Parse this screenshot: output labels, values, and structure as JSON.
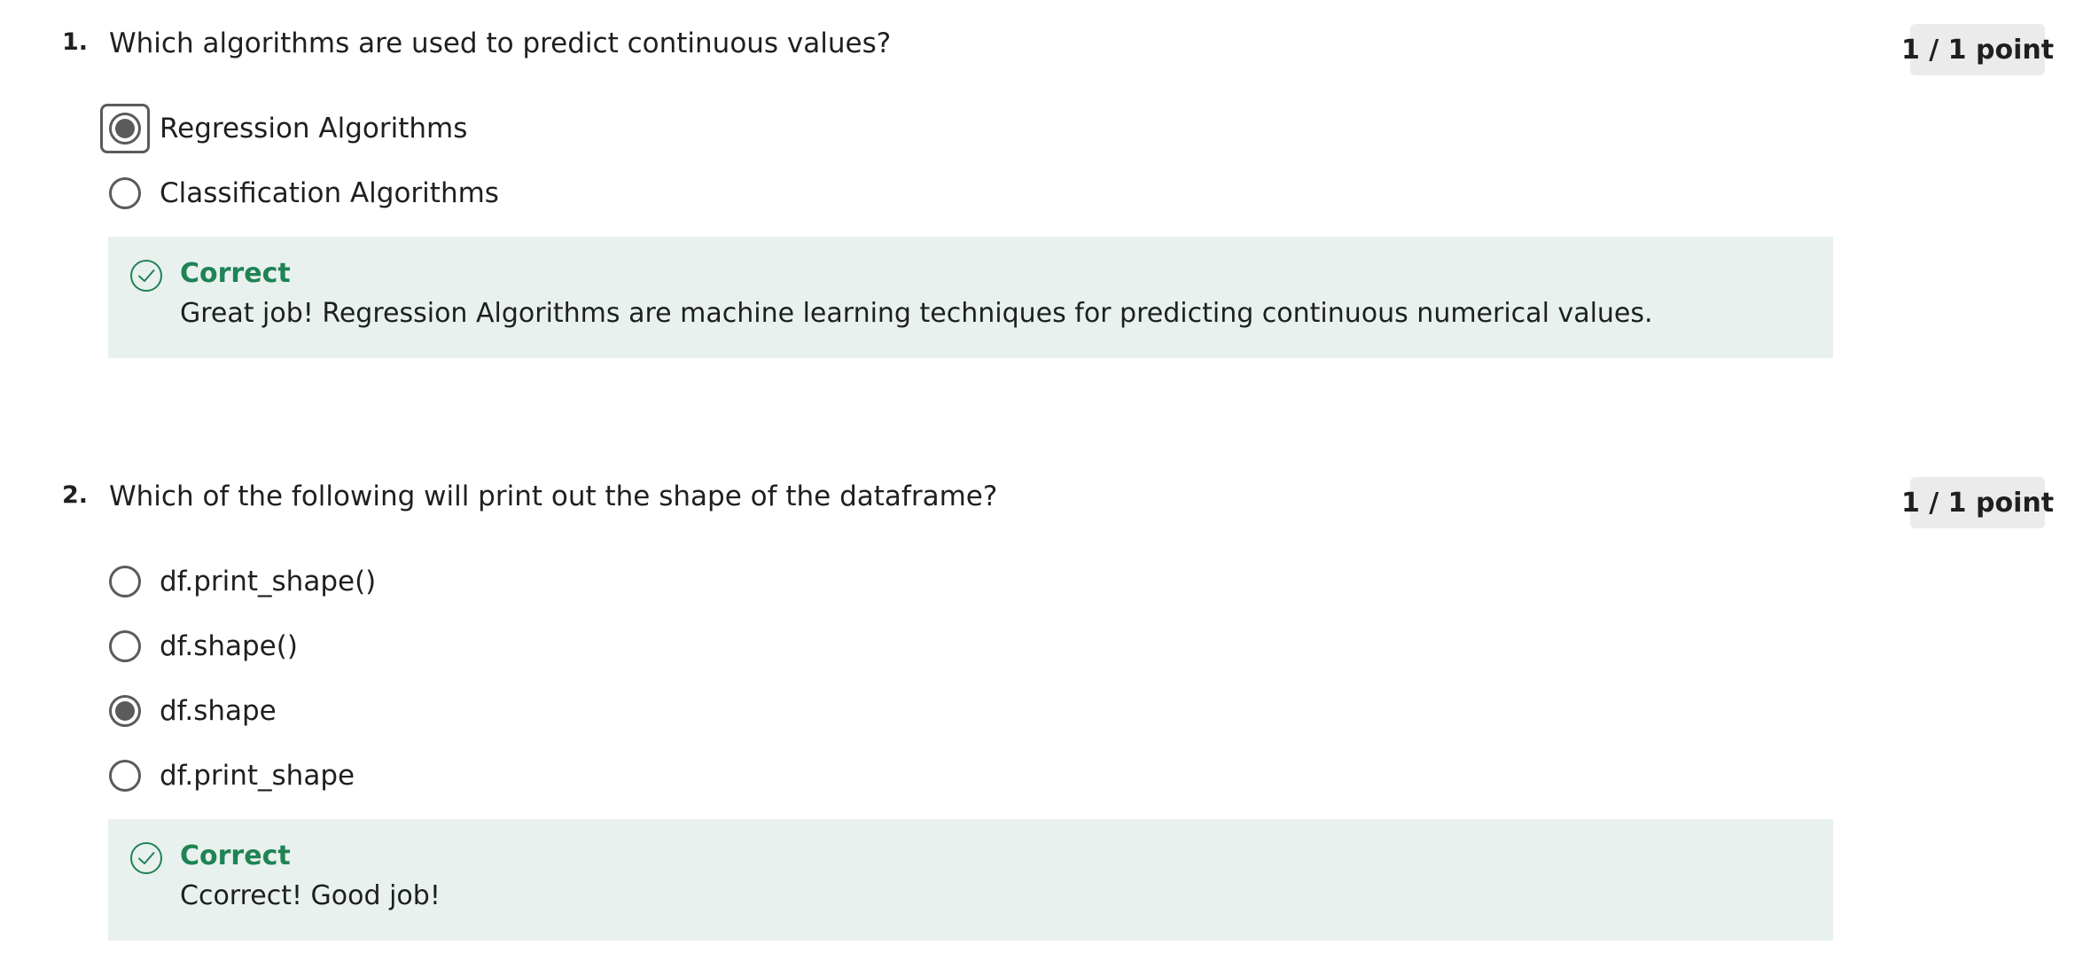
{
  "questions": [
    {
      "number": "1.",
      "text": "Which algorithms are used to predict continuous values?",
      "points": "1 / 1 point",
      "options": [
        {
          "label": "Regression Algorithms",
          "selected": true,
          "focused": true
        },
        {
          "label": "Classification Algorithms",
          "selected": false,
          "focused": false
        }
      ],
      "feedback": {
        "status": "Correct",
        "message": "Great job! Regression Algorithms are machine learning techniques for predicting continuous numerical values.",
        "icon": "check-circle-icon"
      }
    },
    {
      "number": "2.",
      "text": "Which of the following will print out the shape of the dataframe?",
      "points": "1 / 1 point",
      "options": [
        {
          "label": "df.print_shape()",
          "selected": false,
          "focused": false
        },
        {
          "label": "df.shape()",
          "selected": false,
          "focused": false
        },
        {
          "label": "df.shape",
          "selected": true,
          "focused": false
        },
        {
          "label": "df.print_shape",
          "selected": false,
          "focused": false
        }
      ],
      "feedback": {
        "status": "Correct",
        "message": "Ccorrect! Good job!",
        "icon": "check-circle-icon"
      }
    }
  ],
  "colors": {
    "correct_green": "#1f8354",
    "feedback_bg": "#e8f1ee",
    "badge_bg": "#ebebeb",
    "radio_gray": "#5b5b5b",
    "text": "#1f1f1f"
  }
}
